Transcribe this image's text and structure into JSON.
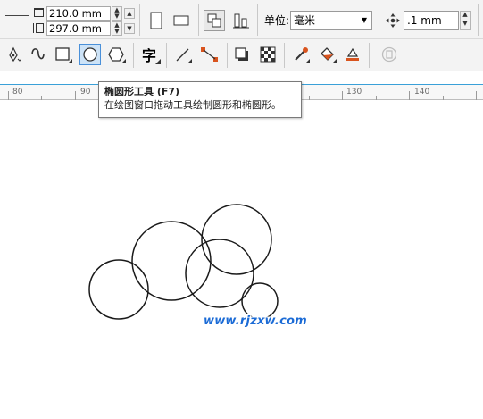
{
  "page_size": {
    "width_value": "210.0 mm",
    "height_value": "297.0 mm"
  },
  "units": {
    "label": "单位:",
    "selected": "毫米"
  },
  "nudge": {
    "value": ".1 mm"
  },
  "tools": {
    "text_tool_glyph": "字"
  },
  "ruler": {
    "ticks": [
      "80",
      "90",
      "130",
      "140"
    ]
  },
  "tooltip": {
    "title": "椭圆形工具 (F7)",
    "description": "在绘图窗口拖动工具绘制圆形和椭圆形。"
  },
  "canvas": {
    "watermark": "www.rjzxw.com",
    "circle_count": 6
  },
  "colors": {
    "toolbar_bg": "#f3f3f3",
    "active_tool_border": "#4a90d9",
    "active_tool_bg": "#cde3f7",
    "ruler_accent": "#3aa0d8",
    "watermark": "#1b6bd6"
  }
}
